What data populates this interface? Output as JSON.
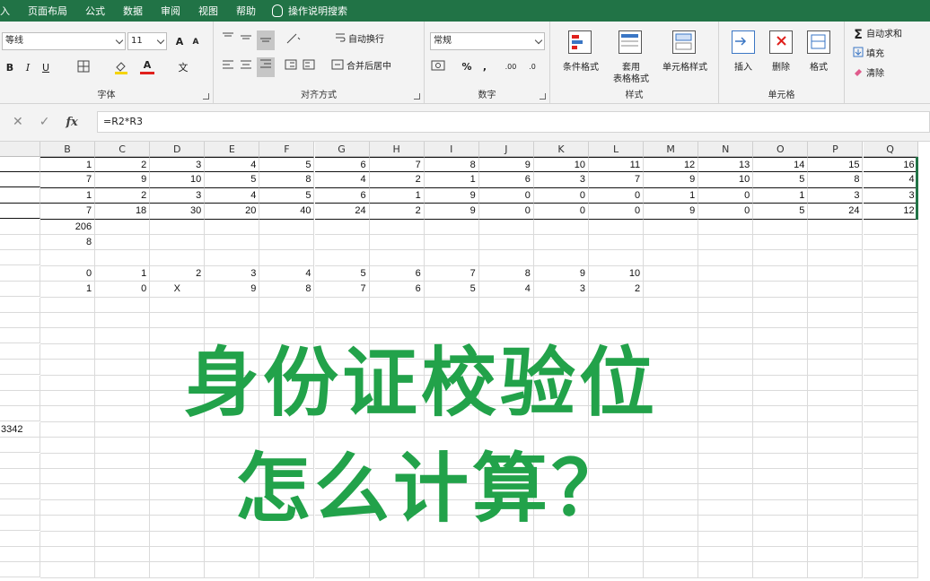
{
  "menu": {
    "items": [
      "入",
      "页面布局",
      "公式",
      "数据",
      "审阅",
      "视图",
      "帮助"
    ],
    "search_label": "操作说明搜索"
  },
  "ribbon": {
    "font": {
      "name": "等线",
      "size": "11",
      "grow": "A",
      "shrink": "A",
      "bold": "B",
      "italic": "I",
      "underline": "U",
      "font_color_letter": "A",
      "phonetic": "文",
      "label": "字体"
    },
    "alignment": {
      "wrap_text": "自动换行",
      "merge_center": "合并后居中",
      "label": "对齐方式"
    },
    "number": {
      "format": "常规",
      "percent": "%",
      "comma": ",",
      "inc_decimal": ".00",
      "dec_decimal": ".0",
      "label": "数字"
    },
    "styles": {
      "conditional": "条件格式",
      "table_line1": "套用",
      "table_line2": "表格格式",
      "cell_styles": "单元格样式",
      "label": "样式"
    },
    "cells": {
      "insert": "插入",
      "delete": "删除",
      "format": "格式",
      "label": "单元格"
    },
    "editing": {
      "autosum": "自动求和",
      "fill": "填充",
      "clear": "清除"
    }
  },
  "formula_bar": {
    "fx_label": "fx",
    "formula": "=R2*R3"
  },
  "sheet": {
    "columns": [
      "B",
      "C",
      "D",
      "E",
      "F",
      "G",
      "H",
      "I",
      "J",
      "K",
      "L",
      "M",
      "N",
      "O",
      "P",
      "Q"
    ],
    "rows": [
      [
        "1",
        "2",
        "3",
        "4",
        "5",
        "6",
        "7",
        "8",
        "9",
        "10",
        "11",
        "12",
        "13",
        "14",
        "15",
        "16"
      ],
      [
        "7",
        "9",
        "10",
        "5",
        "8",
        "4",
        "2",
        "1",
        "6",
        "3",
        "7",
        "9",
        "10",
        "5",
        "8",
        "4"
      ],
      [
        "1",
        "2",
        "3",
        "4",
        "5",
        "6",
        "1",
        "9",
        "0",
        "0",
        "0",
        "1",
        "0",
        "1",
        "3",
        "3"
      ],
      [
        "7",
        "18",
        "30",
        "20",
        "40",
        "24",
        "2",
        "9",
        "0",
        "0",
        "0",
        "9",
        "0",
        "5",
        "24",
        "12"
      ],
      [
        "206"
      ],
      [
        "8"
      ],
      [],
      [
        "0",
        "1",
        "2",
        "3",
        "4",
        "5",
        "6",
        "7",
        "8",
        "9",
        "10"
      ],
      [
        "1",
        "0",
        "X",
        "9",
        "8",
        "7",
        "6",
        "5",
        "4",
        "3",
        "2"
      ]
    ],
    "side_value": "3342"
  },
  "overlay": {
    "line1": "身份证校验位",
    "line2": "怎么计算？"
  },
  "colors": {
    "menu_bg": "#217346",
    "title_green": "#22a24a"
  }
}
